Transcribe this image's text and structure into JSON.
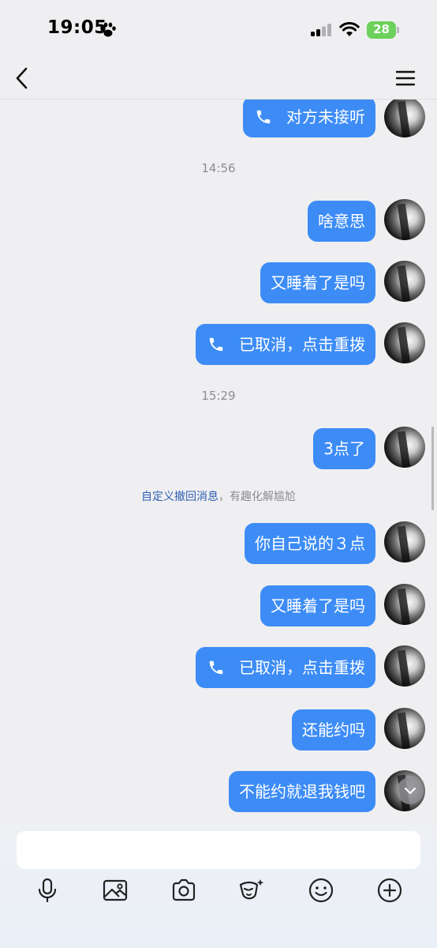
{
  "status_bar": {
    "time": "19:05",
    "battery": "28"
  },
  "nav": {
    "back_icon": "chevron-left-icon",
    "menu_icon": "hamburger-menu-icon"
  },
  "messages": [
    {
      "type": "call",
      "text": "对方未接听"
    },
    {
      "type": "time",
      "text": "14:56"
    },
    {
      "type": "text",
      "text": "啥意思"
    },
    {
      "type": "text",
      "text": "又睡着了是吗"
    },
    {
      "type": "call",
      "text": "已取消，点击重拨"
    },
    {
      "type": "time",
      "text": "15:29"
    },
    {
      "type": "text",
      "text": "3点了"
    },
    {
      "type": "system",
      "link": "自定义撤回消息",
      "text": "，有趣化解尴尬"
    },
    {
      "type": "text",
      "text": "你自己说的３点"
    },
    {
      "type": "text",
      "text": "又睡着了是吗"
    },
    {
      "type": "call",
      "text": "已取消，点击重拨"
    },
    {
      "type": "text",
      "text": "还能约吗"
    },
    {
      "type": "text",
      "text": "不能约就退我钱吧"
    }
  ],
  "input": {
    "placeholder": ""
  },
  "toolbar": [
    "mic-icon",
    "image-icon",
    "camera-icon",
    "face-mask-icon",
    "emoji-icon",
    "plus-icon"
  ],
  "colors": {
    "bubble": "#3d8cf6",
    "background": "#efeff1",
    "link": "#2f5fb3",
    "battery": "#6bd15b"
  }
}
